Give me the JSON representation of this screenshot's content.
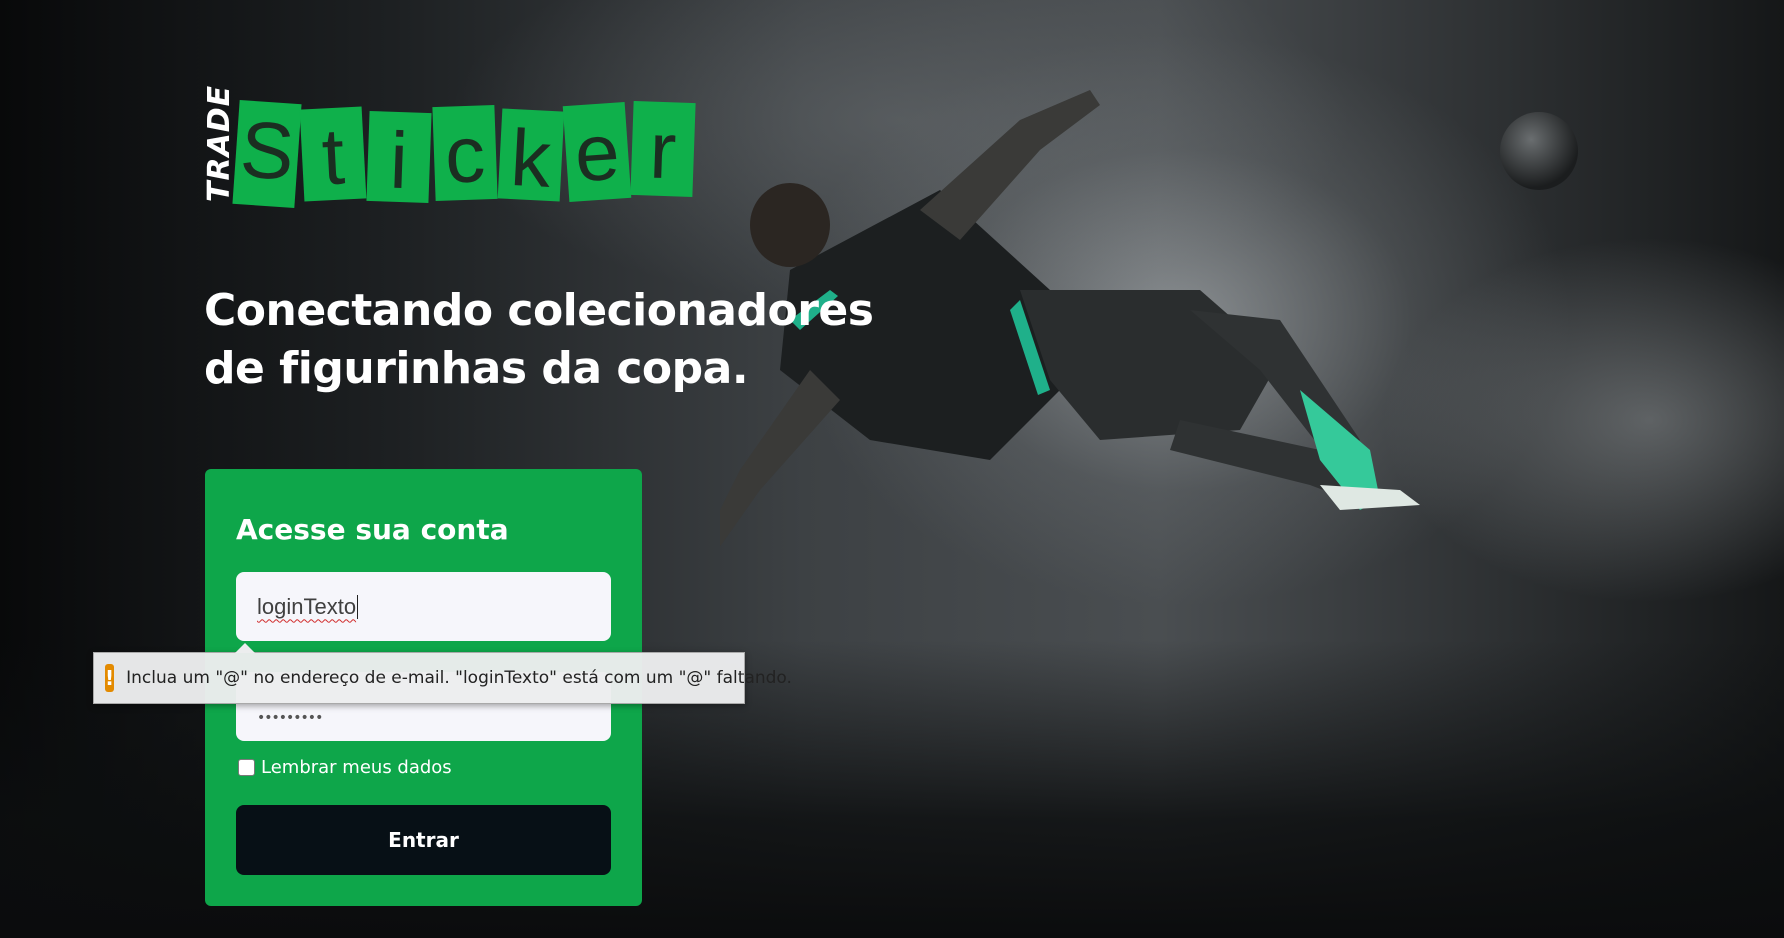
{
  "brand": {
    "prefix": "TRADE",
    "letters": [
      "S",
      "t",
      "i",
      "c",
      "k",
      "e",
      "r"
    ]
  },
  "hero": {
    "headline_line1": "Conectando colecionadores",
    "headline_line2": "de figurinhas da copa."
  },
  "login": {
    "title": "Acesse sua conta",
    "email_value": "loginTexto",
    "password_mask": "•••••••••",
    "remember_label": "Lembrar meus dados",
    "remember_checked": false,
    "submit_label": "Entrar"
  },
  "validation_tooltip": {
    "icon": "warning-icon",
    "message": "Inclua um \"@\" no endereço de e-mail. \"loginTexto\" está com um \"@\" faltando."
  },
  "colors": {
    "accent_green": "#0ea64a",
    "button_dark": "#071016",
    "warning_orange": "#e38a00"
  }
}
